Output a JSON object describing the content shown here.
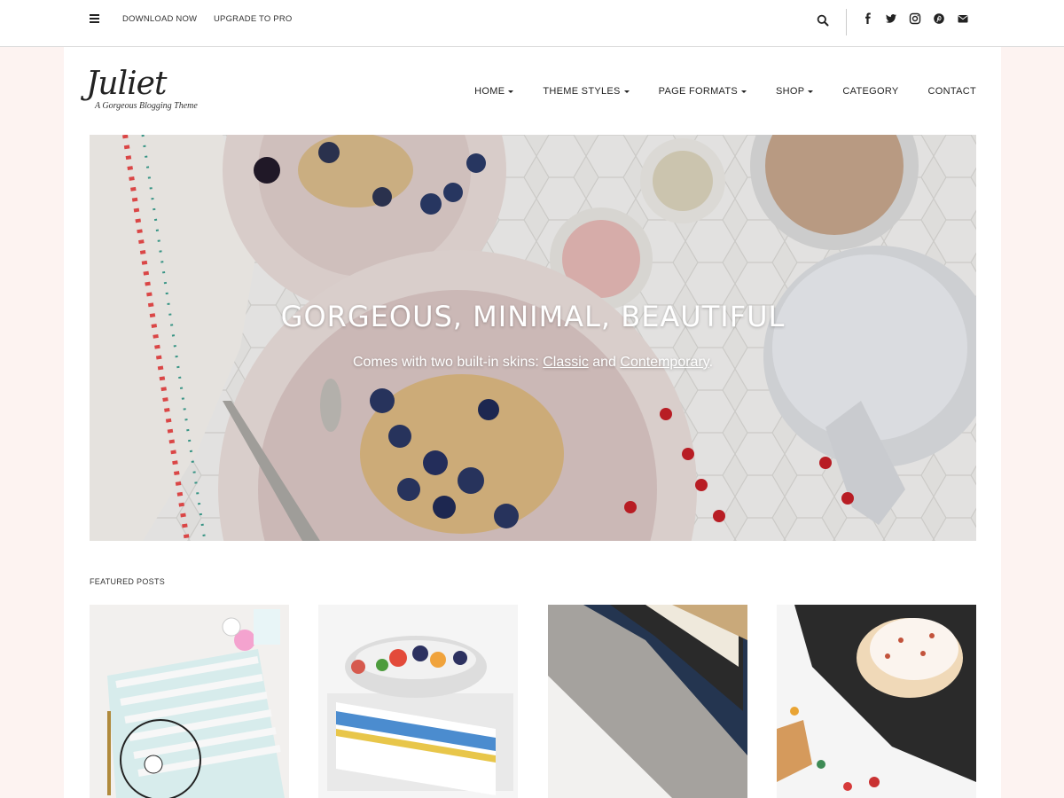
{
  "topbar": {
    "menu_icon": "bars-icon",
    "links": [
      "DOWNLOAD NOW",
      "UPGRADE TO PRO"
    ],
    "search_icon": "search-icon",
    "social_icons": [
      "facebook-icon",
      "twitter-icon",
      "instagram-icon",
      "pinterest-icon",
      "envelope-icon"
    ]
  },
  "logo": {
    "title": "Juliet",
    "tagline": "A Gorgeous Blogging Theme"
  },
  "nav": {
    "items": [
      {
        "label": "HOME",
        "dropdown": true
      },
      {
        "label": "THEME STYLES",
        "dropdown": true
      },
      {
        "label": "PAGE FORMATS",
        "dropdown": true
      },
      {
        "label": "SHOP",
        "dropdown": true
      },
      {
        "label": "CATEGORY",
        "dropdown": false
      },
      {
        "label": "CONTACT",
        "dropdown": false
      }
    ]
  },
  "hero": {
    "title": "GORGEOUS, MINIMAL, BEAUTIFUL",
    "subtitle_prefix": "Comes with two built-in skins: ",
    "link_classic": "Classic",
    "subtitle_and": " and ",
    "link_contemporary": "Contemporary",
    "subtitle_suffix": "."
  },
  "featured": {
    "label": "FEATURED POSTS"
  },
  "colors": {
    "page_bg": "#fdf3f1",
    "text": "#222222",
    "topbar_border": "#dcdcdc"
  }
}
